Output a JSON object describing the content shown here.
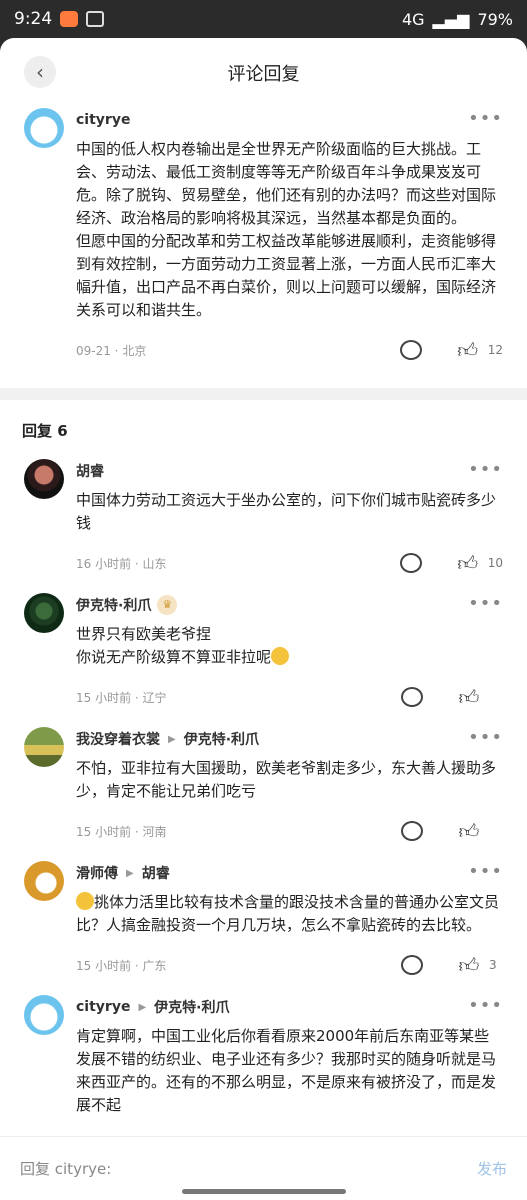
{
  "status": {
    "time": "9:24",
    "battery": "79%",
    "net": "4G"
  },
  "header": {
    "title": "评论回复",
    "back_icon": "chevron-left-icon"
  },
  "main_comment": {
    "user": "cityrye",
    "text": "中国的低人权内卷输出是全世界无产阶级面临的巨大挑战。工会、劳动法、最低工资制度等等无产阶级百年斗争成果岌岌可危。除了脱钩、贸易壁垒，他们还有别的办法吗？而这些对国际经济、政治格局的影响将极其深远，当然基本都是负面的。\n但愿中国的分配改革和劳工权益改革能够进展顺利，走资能够得到有效控制，一方面劳动力工资显著上涨，一方面人民币汇率大幅升值，出口产品不再白菜价，则以上问题可以缓解，国际经济关系可以和谐共生。",
    "meta": "09-21 · 北京",
    "likes": "12"
  },
  "replies_header": "回复 6",
  "replies": [
    {
      "user": "胡睿",
      "reply_to": "",
      "text": "中国体力劳动工资远大于坐办公室的，问下你们城市贴瓷砖多少钱",
      "meta": "16 小时前 · 山东",
      "likes": "10"
    },
    {
      "user": "伊克特·利爪",
      "reply_to": "",
      "text": "世界只有欧美老爷捏\n你说无产阶级算不算亚非拉呢",
      "meta": "15 小时前 · 辽宁",
      "likes": ""
    },
    {
      "user": "我没穿着衣裳",
      "reply_to": "伊克特·利爪",
      "text": "不怕，亚非拉有大国援助，欧美老爷割走多少，东大善人援助多少，肯定不能让兄弟们吃亏",
      "meta": "15 小时前 · 河南",
      "likes": ""
    },
    {
      "user": "滑师傅",
      "reply_to": "胡睿",
      "text": "挑体力活里比较有技术含量的跟没技术含量的普通办公室文员比？人搞金融投资一个月几万块，怎么不拿贴瓷砖的去比较。",
      "meta": "15 小时前 · 广东",
      "likes": "3"
    },
    {
      "user": "cityrye",
      "reply_to": "伊克特·利爪",
      "text": "肯定算啊，中国工业化后你看看原来2000年前后东南亚等某些发展不错的纺织业、电子业还有多少？我那时买的随身听就是马来西亚产的。还有的不那么明显，不是原来有被挤没了，而是发展不起",
      "meta": "",
      "likes": ""
    }
  ],
  "input": {
    "placeholder": "回复 cityrye:",
    "send": "发布"
  }
}
